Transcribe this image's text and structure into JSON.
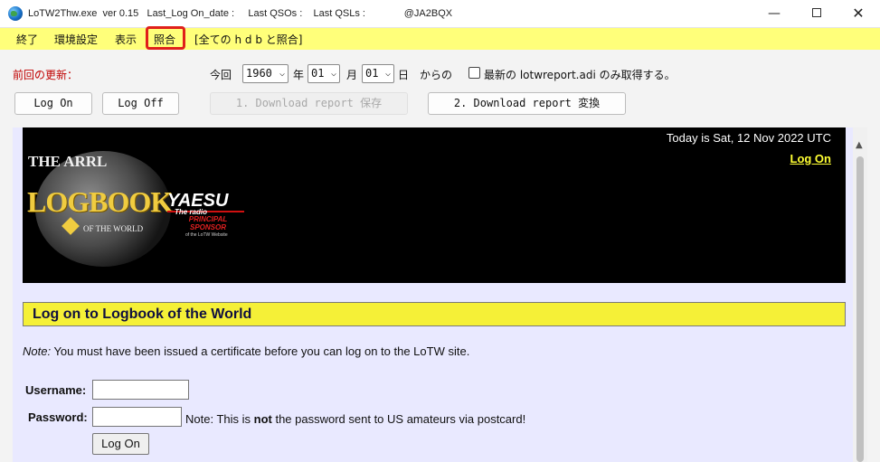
{
  "window": {
    "title": "LoTW2Thw.exe  ver 0.15   Last_Log On_date :     Last QSOs :    Last QSLs :              @JA2BQX",
    "minimize": "—",
    "close": "✕"
  },
  "menu": {
    "items": [
      "終了",
      "環境設定",
      "表示",
      "照合",
      "[全ての h d b と照合]"
    ]
  },
  "controls": {
    "update_label": "前回の更新：",
    "konkai": "今回",
    "year_value": "1960",
    "year_unit": "年",
    "month_value": "01",
    "month_unit": "月",
    "day_value": "01",
    "day_unit": "日",
    "kara": "からの",
    "checkbox_label": "最新の lotwreport.adi のみ取得する。",
    "chevron": "⌵"
  },
  "buttons": {
    "log_on": "Log On",
    "log_off": "Log Off",
    "download_save": "1. Download report  保存",
    "download_convert": "2. Download report 変換"
  },
  "page": {
    "today": "Today is Sat, 12 Nov 2022 UTC",
    "logon_link": "Log On",
    "logo": {
      "arrl": "THE ARRL",
      "logbook": "LOGBOOK",
      "of_the_world": "OF THE WORLD",
      "yaesu": "YAESU",
      "the_radio": "The radio",
      "principal_sponsor": "PRINCIPAL SPONSOR",
      "lotw_website": "of the LoTW Website"
    },
    "section_title": "Log on to Logbook of the World",
    "note_prefix": "Note:",
    "note_text": " You must have been issued a certificate before you can log on to the LoTW site.",
    "username_label": "Username:",
    "password_label": "Password:",
    "pw_note_prefix": "Note: This is ",
    "pw_note_bold": "not",
    "pw_note_suffix": " the password sent to US amateurs via postcard!",
    "submit": "Log On"
  },
  "scroll_up": "▲"
}
